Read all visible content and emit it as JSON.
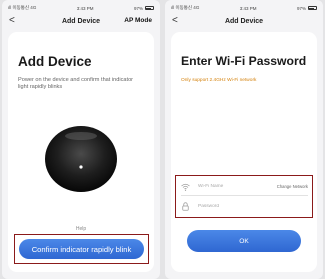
{
  "left_screen": {
    "status": {
      "carrier": "ıll 이동통신 4G",
      "time": "3:43 PM",
      "battery": "97%"
    },
    "nav": {
      "back": "<",
      "title": "Add Device",
      "right_action": "AP Mode"
    },
    "card": {
      "title": "Add Device",
      "description": "Power on the device and confirm that indicator light rapidly blinks",
      "device_icon": "smart-plug-device-image",
      "help": "Help",
      "confirm_button": "Confirm indicator rapidly blink"
    }
  },
  "right_screen": {
    "status": {
      "carrier": "ıll 이동통신 4G",
      "time": "3:43 PM",
      "battery": "97%"
    },
    "nav": {
      "back": "<",
      "title": "Add Device"
    },
    "card": {
      "title": "Enter Wi-Fi Password",
      "note": "Only support 2.4GHz Wi-Fi network",
      "wifi_field": {
        "placeholder": "Wi-Fi Name",
        "icon": "wifi-icon"
      },
      "change_network": "Change Network",
      "password_field": {
        "placeholder": "Password",
        "icon": "lock-icon"
      },
      "ok_button": "OK"
    }
  },
  "colors": {
    "accent": "#3a78e0",
    "highlight_border": "#8b1a1a",
    "warning_text": "#d4800a"
  }
}
